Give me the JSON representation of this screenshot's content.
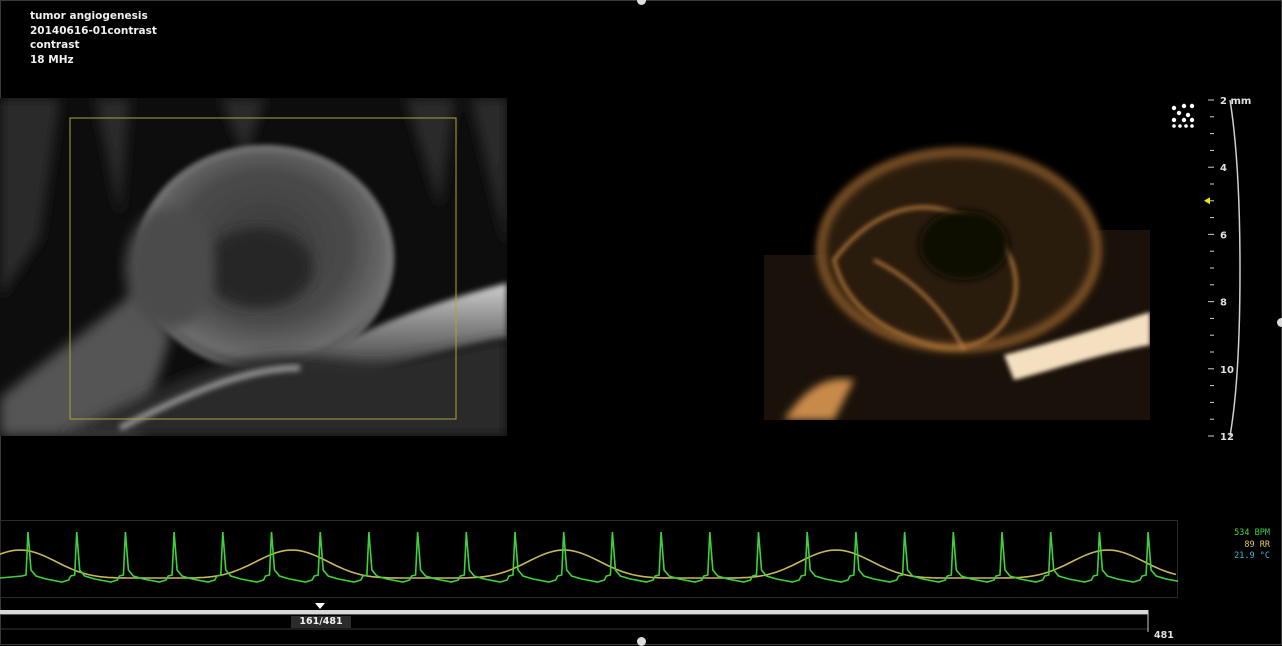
{
  "info": {
    "study": "tumor angiogenesis",
    "series": "20140616-01contrast",
    "mode": "contrast",
    "frequency": "18 MHz"
  },
  "vitals": {
    "heart_rate": "534 BPM",
    "resp_rate": "89 RR",
    "temperature": "21.9 °C",
    "colors": {
      "heart_rate": "#39d44a",
      "resp_rate": "#d8d060",
      "temperature": "#3fb6d8"
    }
  },
  "depth_scale": {
    "unit": "mm",
    "ticks": [
      "2",
      "4",
      "6",
      "8",
      "10",
      "12"
    ],
    "focus_marker_depth": 5
  },
  "playback": {
    "current_frame": "161/481",
    "total_frames": "481"
  },
  "colors": {
    "roi_box": "#a9a636",
    "ecg_trace": "#3fd13a",
    "resp_trace": "#c9b75a",
    "focus_marker": "#f2e600"
  }
}
